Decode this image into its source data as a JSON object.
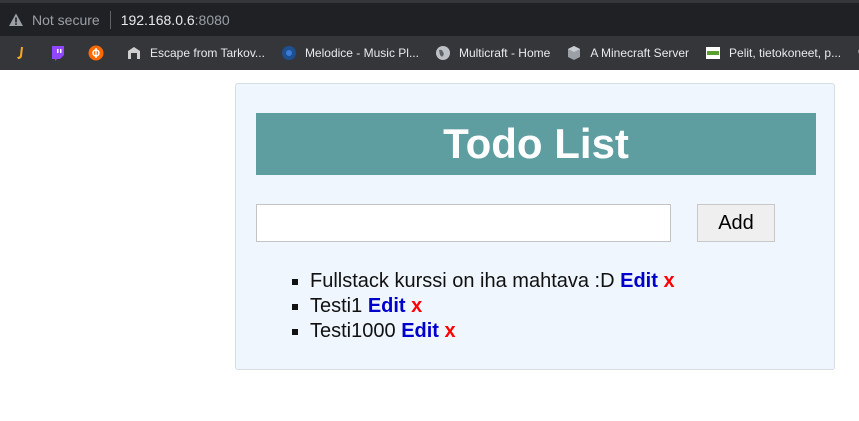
{
  "addressbar": {
    "security_text": "Not secure",
    "host": "192.168.0.6",
    "port": ":8080",
    "icon": "warning-triangle-icon"
  },
  "bookmarks": [
    {
      "label": "",
      "icon": "bookmark-j-icon",
      "color": "#f5a623"
    },
    {
      "label": "",
      "icon": "twitch-icon",
      "color": "#9146ff"
    },
    {
      "label": "",
      "icon": "bookmark-phi-icon",
      "color": "#ff6a00"
    },
    {
      "label": "Escape from Tarkov...",
      "icon": "tarkov-icon",
      "color": "#cfcfcf"
    },
    {
      "label": "Melodice - Music Pl...",
      "icon": "melodice-icon",
      "color": "#1d4f91"
    },
    {
      "label": "Multicraft - Home",
      "icon": "globe-icon",
      "color": "#bdc1c6"
    },
    {
      "label": "A Minecraft Server",
      "icon": "cube-icon",
      "color": "#9aa0a6"
    },
    {
      "label": "Pelit, tietokoneet, p...",
      "icon": "site-icon",
      "color": "#5aa02c"
    },
    {
      "label": "",
      "icon": "search-icon",
      "color": "#e8eaed"
    }
  ],
  "app": {
    "title": "Todo List",
    "input": {
      "value": "",
      "placeholder": ""
    },
    "add_label": "Add",
    "edit_label": "Edit",
    "delete_label": "x",
    "colors": {
      "header_bg": "#5f9ea0",
      "panel_bg": "#eff6fd",
      "edit": "#0000cd",
      "delete": "#ff0000"
    },
    "items": [
      {
        "text": "Fullstack kurssi on iha mahtava :D"
      },
      {
        "text": "Testi1"
      },
      {
        "text": "Testi1000"
      }
    ]
  }
}
